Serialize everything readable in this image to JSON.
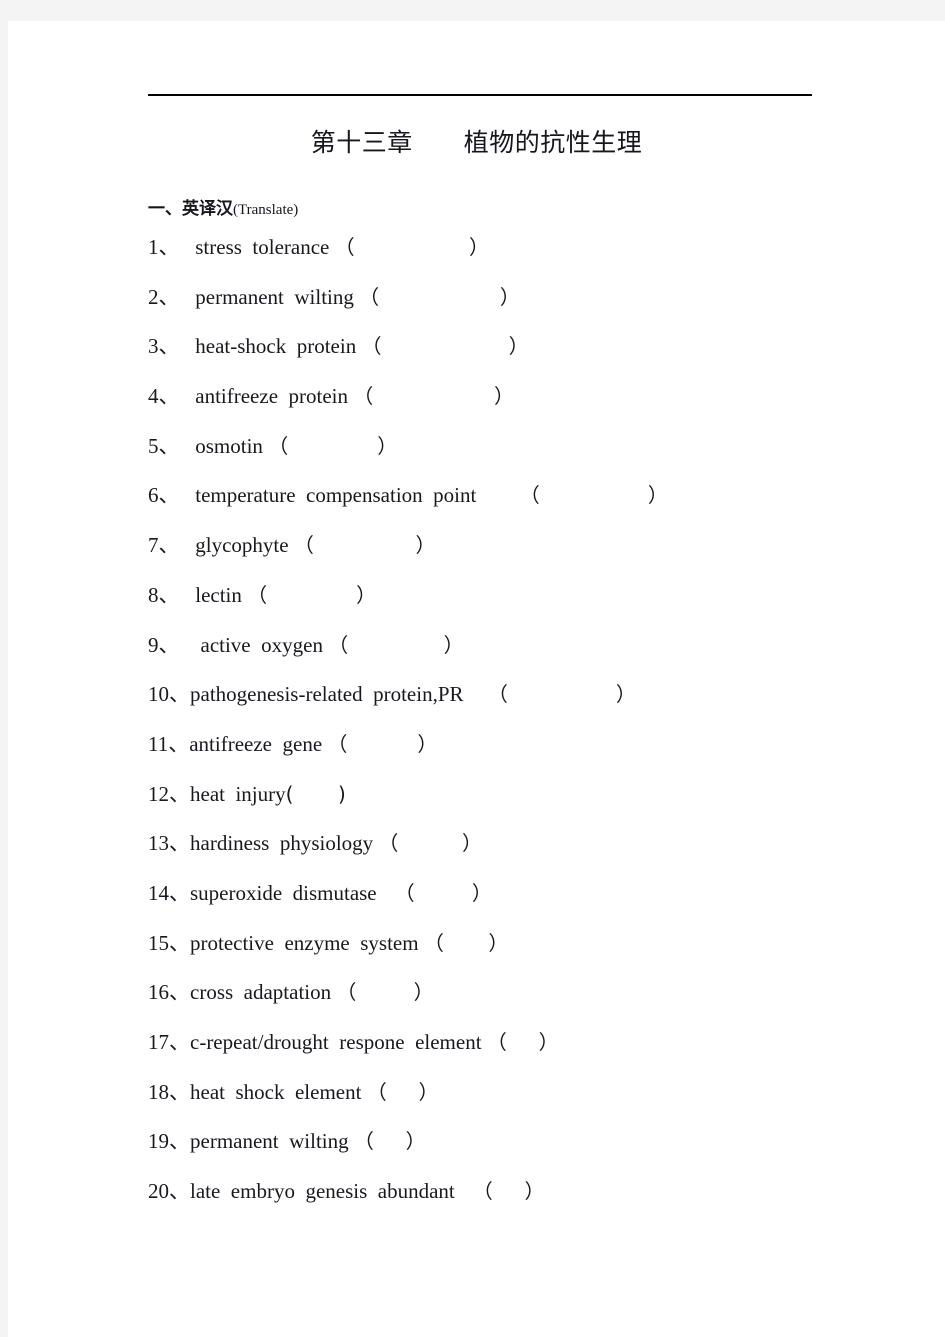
{
  "page": {
    "background_color": "#f4f4f4",
    "paper_color": "#ffffff",
    "text_color": "#18181f"
  },
  "header": {
    "rule": "horizontal-rule",
    "title": "第十三章　　植物的抗性生理"
  },
  "section": {
    "number_cn": "一、",
    "label_cn": "英译汉",
    "label_en": "(Translate)"
  },
  "terms": [
    {
      "index": "1、",
      "lead": "   ",
      "text": "stress  tolerance ",
      "blank": "（                  ）"
    },
    {
      "index": "2、",
      "lead": "   ",
      "text": "permanent  wilting ",
      "blank": "（                   ）"
    },
    {
      "index": "3、",
      "lead": "   ",
      "text": "heat-shock  protein ",
      "blank": "（                    ）"
    },
    {
      "index": "4、",
      "lead": "   ",
      "text": "antifreeze  protein ",
      "blank": "（                   ）"
    },
    {
      "index": "5、",
      "lead": "   ",
      "text": "osmotin ",
      "blank": "（              ）"
    },
    {
      "index": "6、",
      "lead": "   ",
      "text": "temperature  compensation  point ",
      "blank": "      （                 ）"
    },
    {
      "index": "7、",
      "lead": "   ",
      "text": "glycophyte ",
      "blank": "（                ）"
    },
    {
      "index": "8、",
      "lead": "   ",
      "text": "lectin ",
      "blank": "（              ）"
    },
    {
      "index": "9、",
      "lead": "   ",
      "text": " active  oxygen ",
      "blank": "（               ）"
    },
    {
      "index": "10、",
      "lead": "",
      "text": "pathogenesis-related  protein,PR ",
      "blank": "   （                 ）"
    },
    {
      "index": "11、",
      "lead": "",
      "text": "antifreeze  gene ",
      "blank": "（           ）"
    },
    {
      "index": "12、",
      "lead": "",
      "text": "heat  injury",
      "blank": "(       )"
    },
    {
      "index": "13、",
      "lead": "",
      "text": "hardiness  physiology ",
      "blank": "（          ）"
    },
    {
      "index": "14、",
      "lead": "",
      "text": "superoxide  dismutase ",
      "blank": "  （         ）"
    },
    {
      "index": "15、",
      "lead": "",
      "text": "protective  enzyme  system ",
      "blank": "（       ）"
    },
    {
      "index": "16、",
      "lead": "",
      "text": "cross  adaptation ",
      "blank": "（         ）"
    },
    {
      "index": "17、",
      "lead": "",
      "text": "c-repeat/drought  respone  element ",
      "blank": "（     ）"
    },
    {
      "index": "18、",
      "lead": "",
      "text": "heat  shock  element ",
      "blank": "（     ）"
    },
    {
      "index": "19、",
      "lead": "",
      "text": "permanent  wilting ",
      "blank": "（     ）"
    },
    {
      "index": "20、",
      "lead": "",
      "text": "late  embryo  genesis  abundant ",
      "blank": "  （     ）"
    }
  ]
}
